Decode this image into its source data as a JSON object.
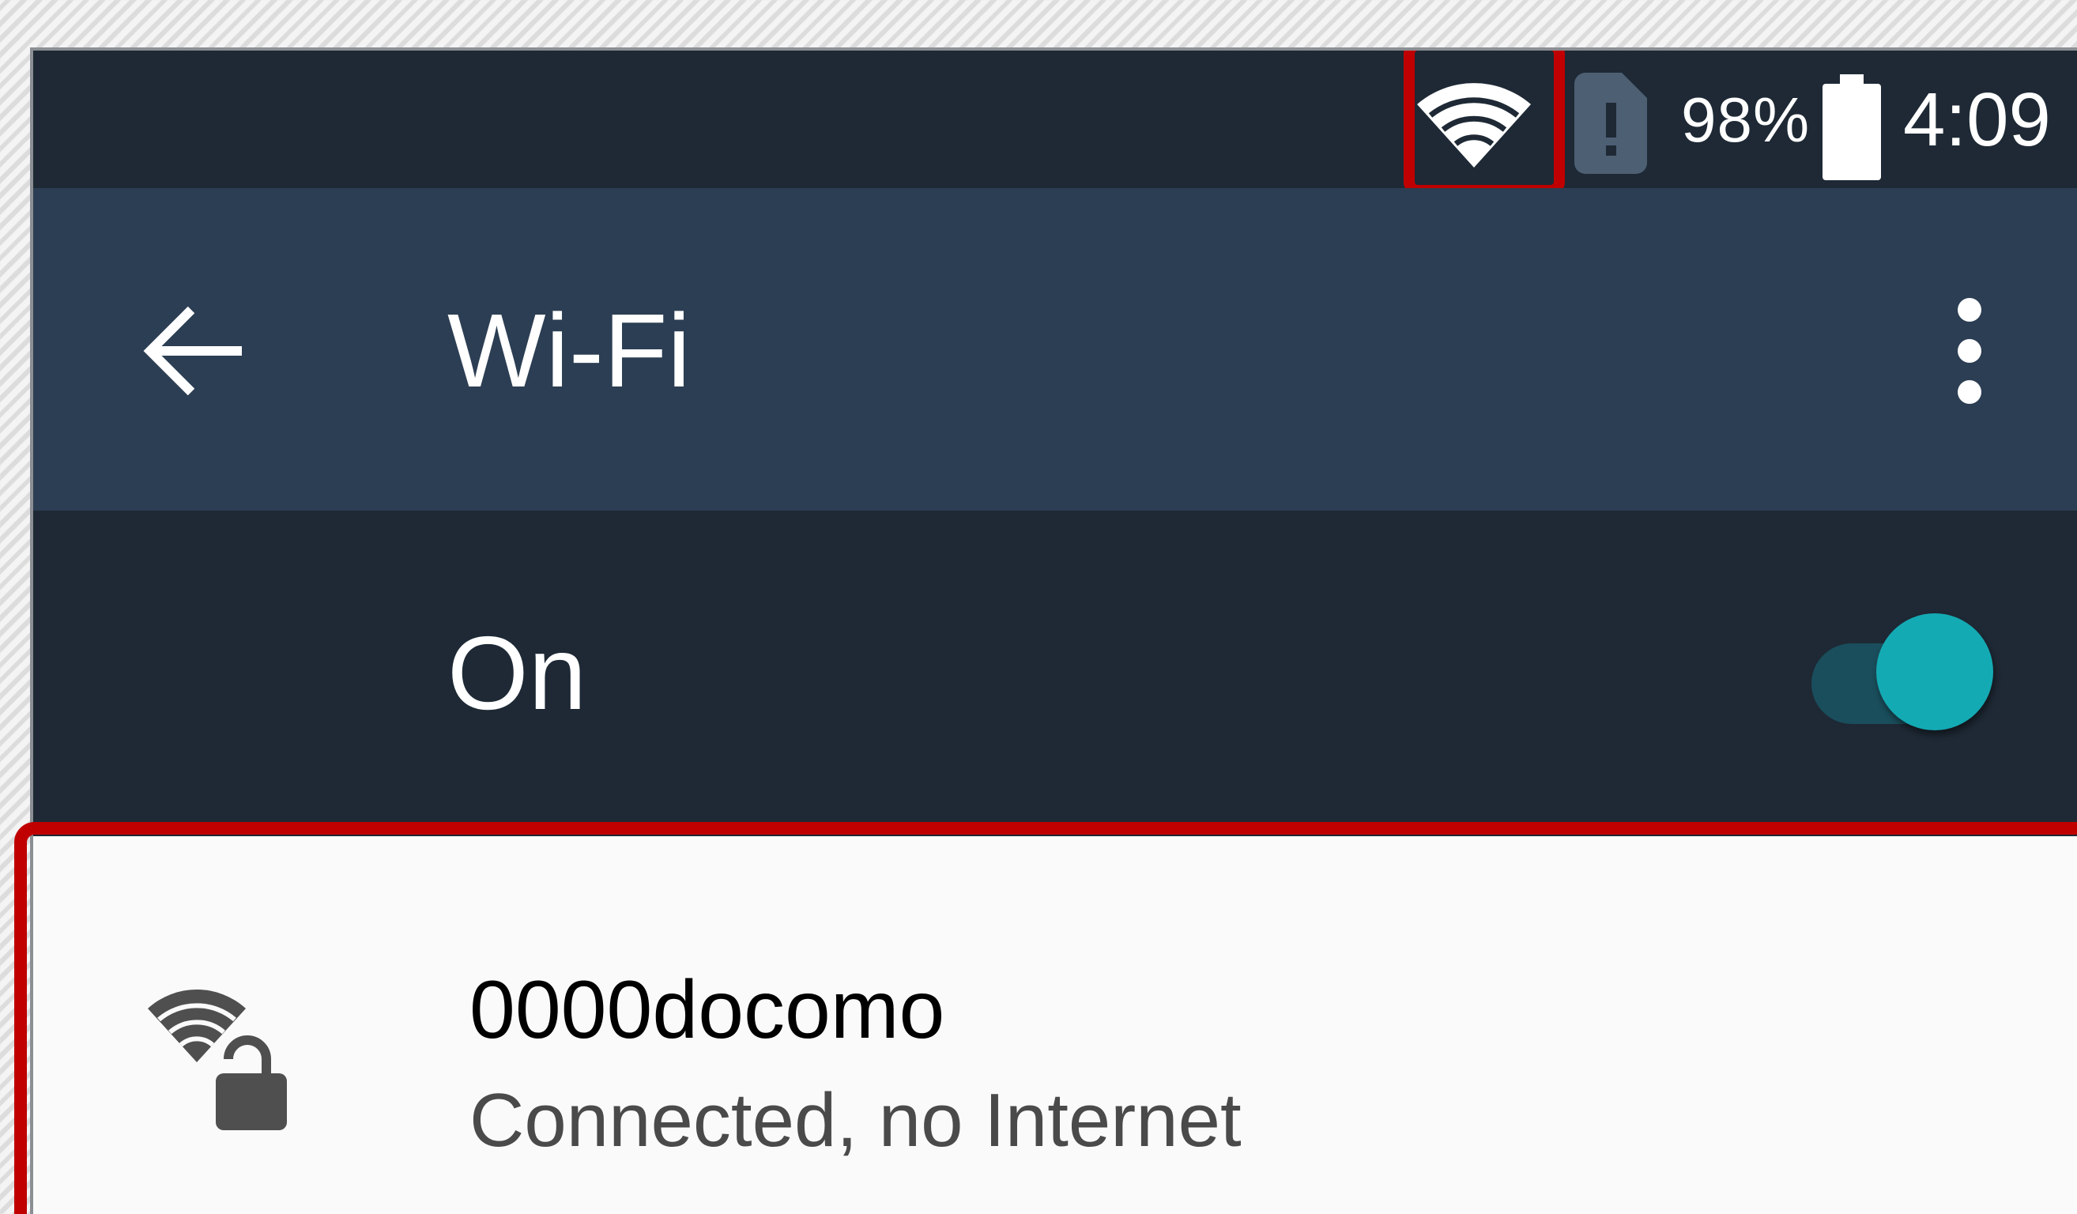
{
  "status_bar": {
    "wifi_icon": "wifi-full-icon",
    "sim_icon": "sim-card-alert-icon",
    "battery_percent": "98%",
    "battery_icon": "battery-icon",
    "time": "4:09",
    "highlight_color": "#c00000"
  },
  "app_bar": {
    "back_icon": "arrow-back-icon",
    "title": "Wi-Fi",
    "overflow_icon": "more-vert-icon",
    "background_color": "#2c3e53"
  },
  "wifi_toggle": {
    "label": "On",
    "state": true,
    "accent_color": "#14aab4"
  },
  "networks": [
    {
      "name": "0000docomo",
      "status": "Connected, no Internet",
      "icon": "wifi-lock-icon",
      "secured": true
    }
  ],
  "colors": {
    "status_bar_bg": "#1e2935",
    "toggle_row_bg": "#1e2935",
    "list_bg": "#fafafa",
    "highlight": "#c00000"
  }
}
